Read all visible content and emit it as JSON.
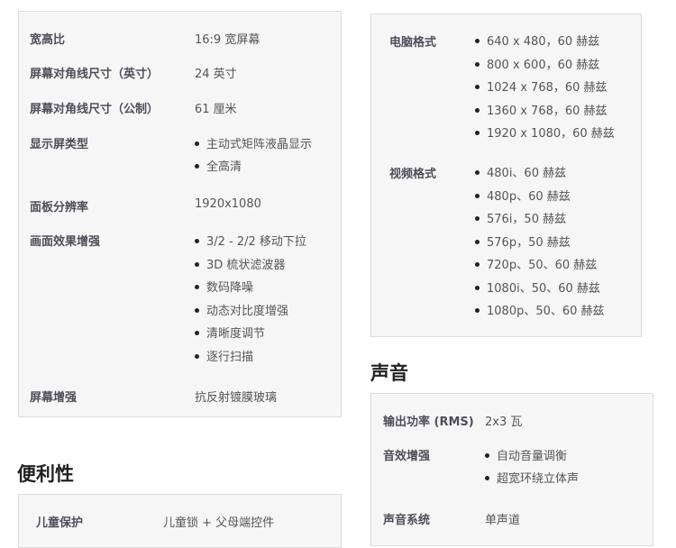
{
  "display_specs": [
    {
      "label": "宽高比",
      "value": "16:9 宽屏幕"
    },
    {
      "label": "屏幕对角线尺寸（英寸）",
      "value": "24  英寸"
    },
    {
      "label": "屏幕对角线尺寸（公制）",
      "value": "61  厘米"
    },
    {
      "label": "显示屏类型",
      "items": [
        "主动式矩阵液晶显示",
        "全高清"
      ]
    },
    {
      "label": "面板分辨率",
      "value": "1920x1080"
    },
    {
      "label": "画面效果增强",
      "items": [
        "3/2 - 2/2 移动下拉",
        "3D 梳状滤波器",
        "数码降噪",
        "动态对比度增强",
        "清晰度调节",
        "逐行扫描"
      ]
    },
    {
      "label": "屏幕增强",
      "value": "抗反射镀膜玻璃"
    }
  ],
  "formats": [
    {
      "label": "电脑格式",
      "items": [
        "640 x 480，60 赫兹",
        "800 x 600，60 赫兹",
        "1024 x 768，60 赫兹",
        "1360 x 768，60 赫兹",
        "1920 x 1080，60 赫兹"
      ]
    },
    {
      "label": "视频格式",
      "items": [
        "480i、60 赫兹",
        "480p、60 赫兹",
        "576i，50 赫兹",
        "576p，50 赫兹",
        "720p、50、60 赫兹",
        "1080i、50、60 赫兹",
        "1080p、50、60 赫兹"
      ]
    }
  ],
  "convenience": {
    "heading": "便利性",
    "rows": [
      {
        "label": "儿童保护",
        "value": "儿童锁 + 父母端控件"
      }
    ]
  },
  "sound": {
    "heading": "声音",
    "rows": [
      {
        "label": "输出功率 (RMS)",
        "value": "2x3 瓦"
      },
      {
        "label": "音效增强",
        "items": [
          "自动音量调衡",
          "超宽环绕立体声"
        ]
      },
      {
        "label": "声音系统",
        "value": "单声道"
      }
    ]
  }
}
